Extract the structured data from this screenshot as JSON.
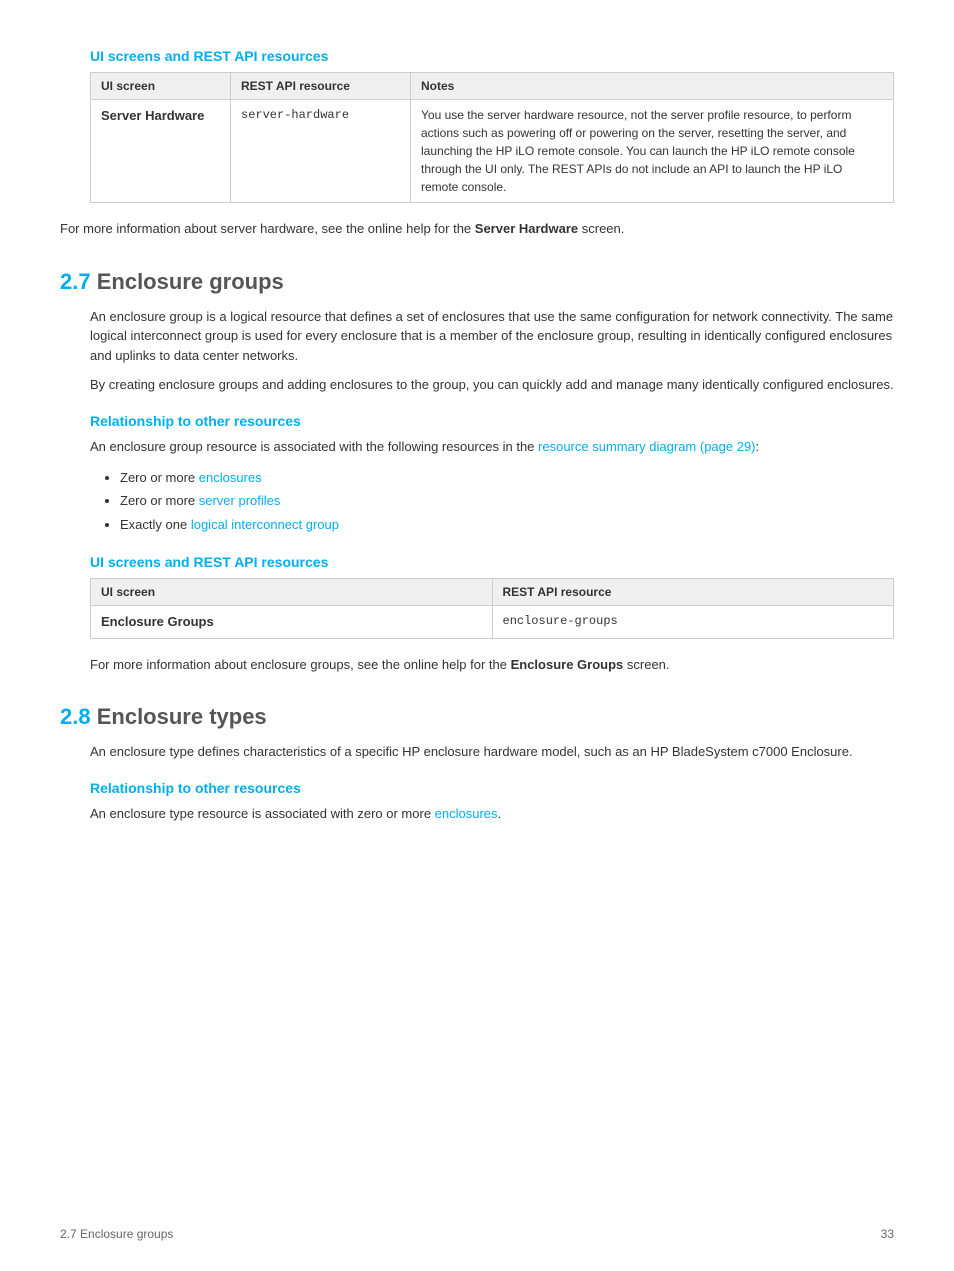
{
  "top_table": {
    "section_title": "UI screens and REST API resources",
    "headers": [
      "UI screen",
      "REST API resource",
      "Notes"
    ],
    "rows": [
      {
        "ui_screen": "Server Hardware",
        "rest_resource": "server-hardware",
        "notes": "You use the server hardware resource, not the server profile resource, to perform actions such as powering off or powering on the server, resetting the server, and launching the HP iLO remote console. You can launch the HP iLO remote console through the UI only. The REST APIs do not include an API to launch the HP iLO remote console."
      }
    ]
  },
  "top_paragraph": "For more information about server hardware, see the online help for the ",
  "top_paragraph_bold": "Server Hardware",
  "top_paragraph_end": " screen.",
  "section_27": {
    "number": "2.7",
    "title": "Enclosure groups",
    "intro1": "An enclosure group is a logical resource that defines a set of enclosures that use the same configuration for network connectivity. The same logical interconnect group is used for every enclosure that is a member of the enclosure group, resulting in identically configured enclosures and uplinks to data center networks.",
    "intro2": "By creating enclosure groups and adding enclosures to the group, you can quickly add and manage many identically configured enclosures.",
    "relationship_heading": "Relationship to other resources",
    "relationship_intro": "An enclosure group resource is associated with the following resources in the ",
    "relationship_link_text": "resource summary diagram (page 29)",
    "relationship_intro_end": ":",
    "bullet_items": [
      {
        "prefix": "Zero or more ",
        "link_text": "enclosures",
        "suffix": ""
      },
      {
        "prefix": "Zero or more ",
        "link_text": "server profiles",
        "suffix": ""
      },
      {
        "prefix": "Exactly one ",
        "link_text": "logical interconnect group",
        "suffix": ""
      }
    ],
    "ui_table_heading": "UI screens and REST API resources",
    "ui_table_headers": [
      "UI screen",
      "REST API resource"
    ],
    "ui_table_rows": [
      {
        "ui_screen": "Enclosure Groups",
        "rest_resource": "enclosure-groups"
      }
    ],
    "footer_para_prefix": "For more information about enclosure groups, see the online help for the ",
    "footer_para_bold": "Enclosure Groups",
    "footer_para_suffix": " screen."
  },
  "section_28": {
    "number": "2.8",
    "title": "Enclosure types",
    "intro": "An enclosure type defines characteristics of a specific HP enclosure hardware model, such as an HP BladeSystem c7000 Enclosure.",
    "relationship_heading": "Relationship to other resources",
    "relationship_para_prefix": "An enclosure type resource is associated with zero or more ",
    "relationship_link_text": "enclosures",
    "relationship_para_suffix": "."
  },
  "footer": {
    "left": "2.7 Enclosure groups",
    "right": "33"
  }
}
